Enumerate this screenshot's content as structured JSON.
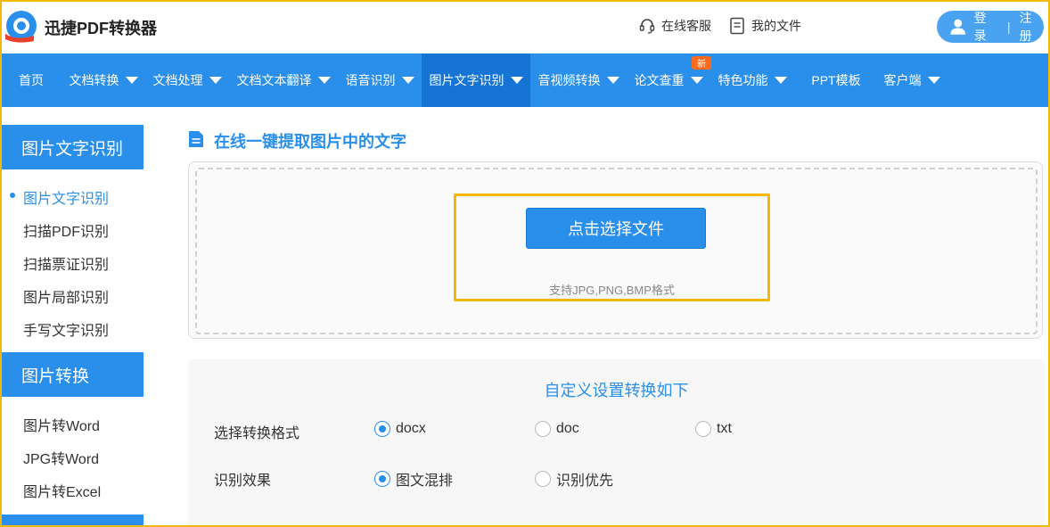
{
  "header": {
    "logo_text": "迅捷PDF转换器",
    "service_label": "在线客服",
    "files_label": "我的文件",
    "login_label": "登录",
    "register_label": "注册"
  },
  "nav": {
    "items": [
      {
        "label": "首页",
        "has_caret": false
      },
      {
        "label": "文档转换",
        "has_caret": true
      },
      {
        "label": "文档处理",
        "has_caret": true
      },
      {
        "label": "文档文本翻译",
        "has_caret": true
      },
      {
        "label": "语音识别",
        "has_caret": true
      },
      {
        "label": "图片文字识别",
        "has_caret": true,
        "active": true
      },
      {
        "label": "音视频转换",
        "has_caret": true
      },
      {
        "label": "论文查重",
        "has_caret": true
      },
      {
        "label": "特色功能",
        "has_caret": true
      },
      {
        "label": "PPT模板",
        "has_caret": false
      },
      {
        "label": "客户端",
        "has_caret": true
      }
    ],
    "new_badge": "新"
  },
  "sidebar": {
    "sections": [
      {
        "title": "图片文字识别",
        "items": [
          "图片文字识别",
          "扫描PDF识别",
          "扫描票证识别",
          "图片局部识别",
          "手写文字识别"
        ]
      },
      {
        "title": "图片转换",
        "items": [
          "图片转Word",
          "JPG转Word",
          "图片转Excel"
        ]
      }
    ]
  },
  "main": {
    "section_title": "在线一键提取图片中的文字",
    "choose_button": "点击选择文件",
    "formats_hint": "支持JPG,PNG,BMP格式",
    "settings_title": "自定义设置转换如下",
    "format_row": {
      "label": "选择转换格式",
      "options": [
        "docx",
        "doc",
        "txt"
      ],
      "selected": "docx"
    },
    "effect_row": {
      "label": "识别效果",
      "options": [
        "图文混排",
        "识别优先"
      ],
      "selected": "图文混排"
    }
  },
  "colors": {
    "accent": "#2a8fea",
    "nav_active": "#1574d4",
    "highlight": "#f5b800",
    "badge": "#ff6a1a"
  }
}
